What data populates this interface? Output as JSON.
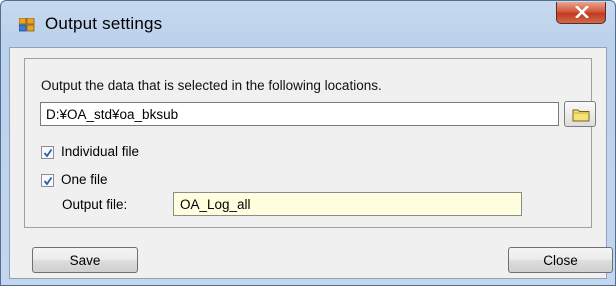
{
  "window": {
    "title": "Output settings",
    "close_icon": "close-x-icon",
    "app_icon": "window-app-icon"
  },
  "panel": {
    "instruction": "Output the data that is selected in the following locations.",
    "path_value": "D:¥OA_std¥oa_bksub",
    "folder_icon": "folder-icon",
    "individual_file": {
      "label": "Individual file",
      "checked": true
    },
    "one_file": {
      "label": "One file",
      "checked": true
    },
    "output_file_label": "Output file:",
    "output_file_value": "OA_Log_all"
  },
  "buttons": {
    "save_label": "Save",
    "close_label": "Close"
  },
  "colors": {
    "accent": "#2b72c8",
    "output_field_bg": "#ffffe0",
    "close_button": "#c9482b"
  }
}
